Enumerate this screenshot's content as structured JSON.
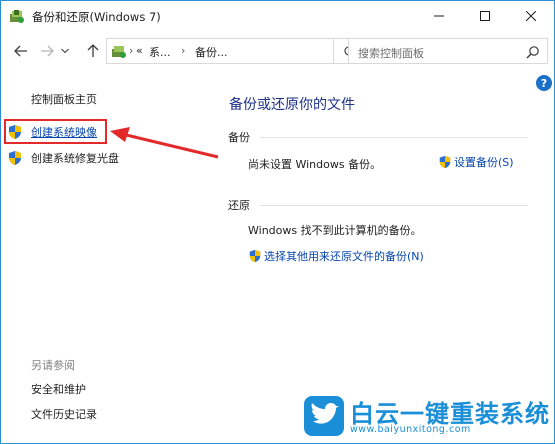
{
  "window": {
    "title": "备份和还原(Windows 7)"
  },
  "navigation": {
    "breadcrumb": {
      "overflow": "«",
      "crumb_1": "系...",
      "crumb_2": "备份..."
    },
    "search_placeholder": "搜索控制面板"
  },
  "left_pane": {
    "home": "控制面板主页",
    "tasks": [
      {
        "label": "创建系统映像",
        "icon": "uac-shield-icon"
      },
      {
        "label": "创建系统修复光盘",
        "icon": "uac-shield-icon"
      }
    ],
    "see_also": {
      "heading": "另请参阅",
      "items": [
        "安全和维护",
        "文件历史记录"
      ]
    }
  },
  "main": {
    "title": "备份或还原你的文件",
    "backup": {
      "heading": "备份",
      "status": "尚未设置 Windows 备份。",
      "action": "设置备份(S)"
    },
    "restore": {
      "heading": "还原",
      "status": "Windows 找不到此计算机的备份。",
      "action": "选择其他用来还原文件的备份(N)"
    }
  },
  "watermark": {
    "title": "白云一键重装系统",
    "url": "www.baiyunxitong.com"
  },
  "colors": {
    "link": "#0645ad",
    "heading": "#1e3287",
    "annotation": "#e32a2a",
    "watermark": "#1a8fd8",
    "border": "#2b8fd6"
  }
}
